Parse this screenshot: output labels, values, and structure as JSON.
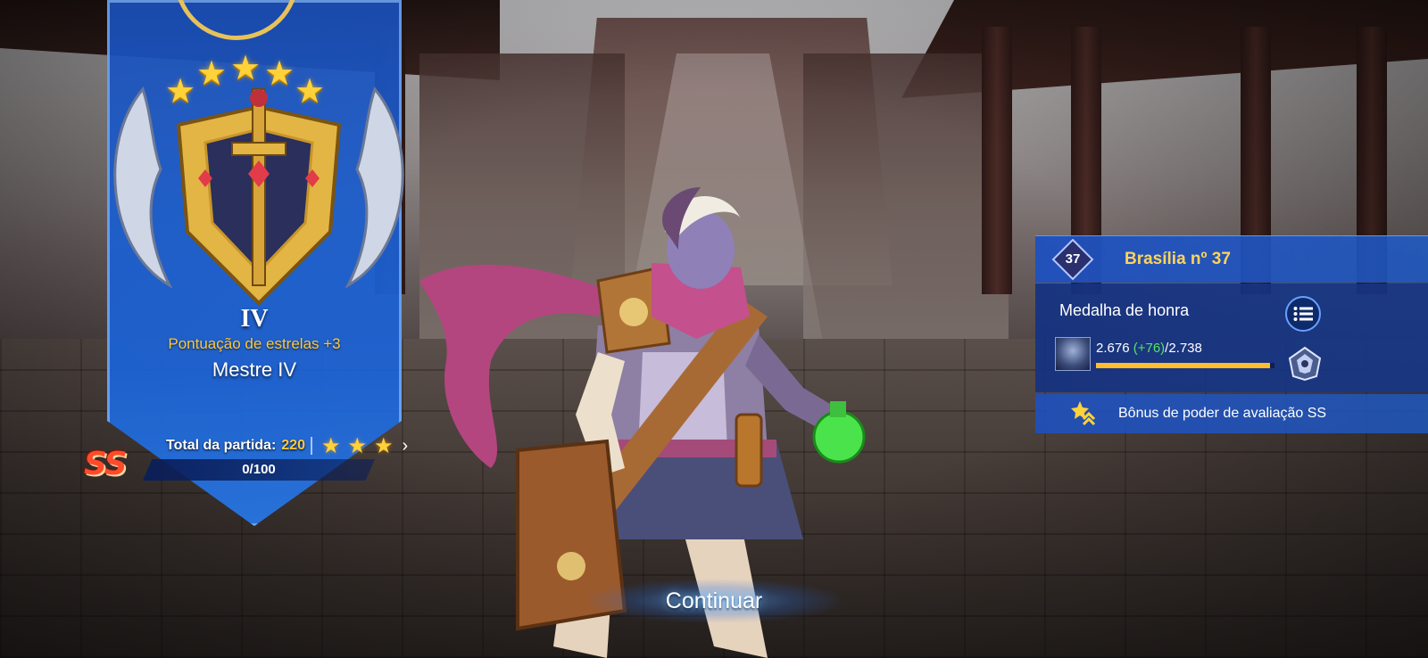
{
  "rank": {
    "stars": 5,
    "tier_roman": "IV",
    "star_points": "Pontuação de estrelas +3",
    "name": "Mestre IV"
  },
  "match": {
    "total_label": "Total da partida:",
    "total_value": "220",
    "stars": 3
  },
  "ss_grade": {
    "badge": "SS",
    "progress_text": "0/100",
    "progress_fraction": 0
  },
  "region": {
    "level": "37",
    "title": "Brasília nº 37"
  },
  "medal": {
    "title": "Medalha de honra",
    "score": "2.676",
    "delta": "(+76)",
    "max": "/2.738",
    "progress_fraction": 0.977
  },
  "bonus": {
    "text": "Bônus de poder de avaliação SS"
  },
  "actions": {
    "continue_label": "Continuar"
  },
  "icons": {
    "medal_list": "list-icon",
    "medal_rank": "rank-emblem-icon",
    "bonus": "rating-bonus-icon",
    "match_stars": "star-icon",
    "chevron": "chevron-right-icon"
  },
  "colors": {
    "accent_blue": "#1a5ed0",
    "gold": "#ffc93b",
    "delta_green": "#55e36a",
    "ss_red": "#ff4b2b"
  }
}
